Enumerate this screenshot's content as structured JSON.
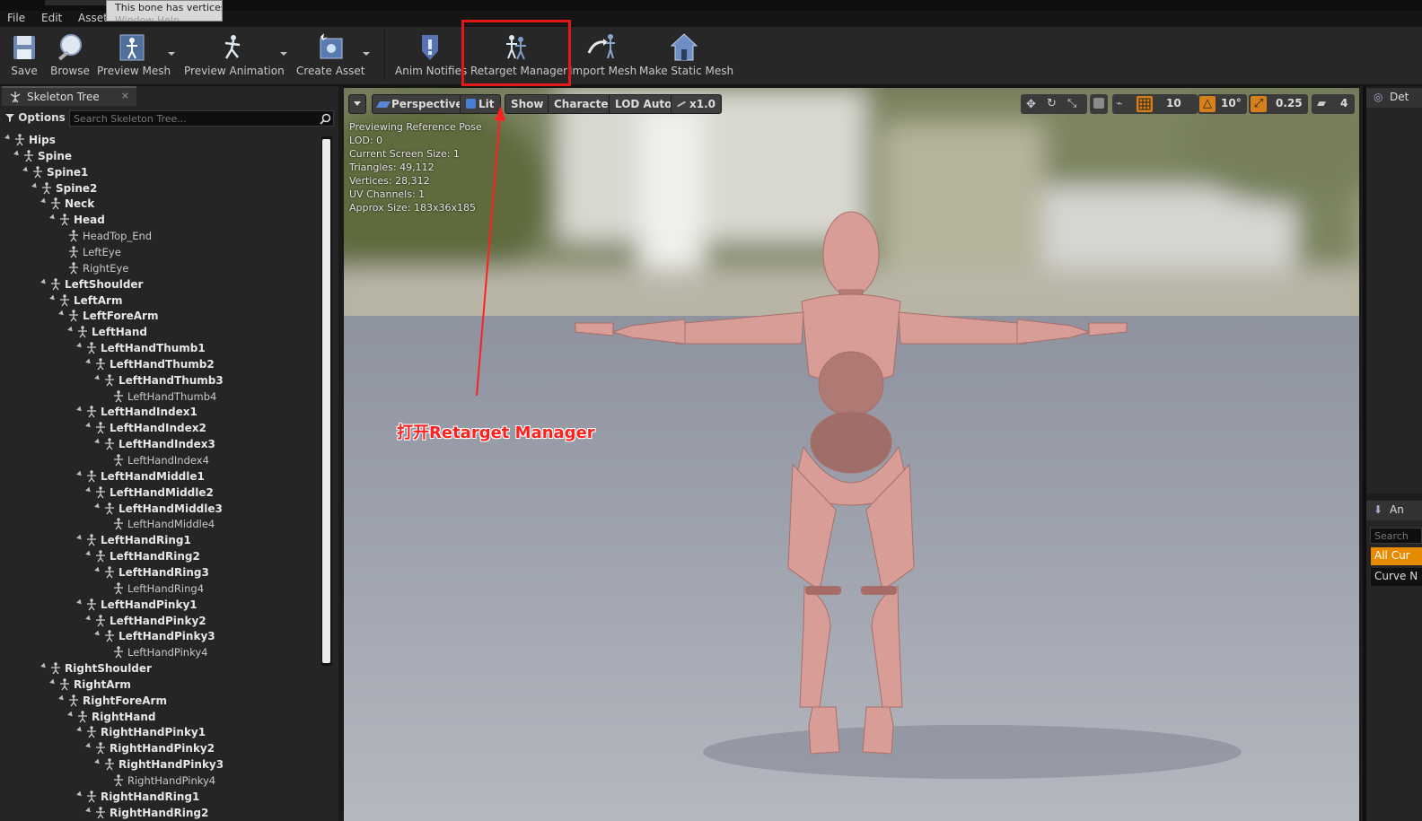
{
  "window": {
    "tooltip": {
      "line1": "This bone has vertices w",
      "line2": "Window   Help"
    }
  },
  "menu": [
    "File",
    "Edit",
    "Asset",
    "Window",
    "Help"
  ],
  "toolbar": {
    "buttons": [
      {
        "label": "Save",
        "icon": "save-icon"
      },
      {
        "label": "Browse",
        "icon": "browse-icon"
      },
      {
        "label": "Preview Mesh",
        "icon": "preview-mesh-icon"
      },
      {
        "label": "Preview Animation",
        "icon": "preview-animation-icon"
      },
      {
        "label": "Create Asset",
        "icon": "create-asset-icon"
      },
      {
        "label": "Anim Notifies",
        "icon": "anim-notifies-icon"
      },
      {
        "label": "Retarget Manager",
        "icon": "retarget-manager-icon"
      },
      {
        "label": "Import Mesh",
        "icon": "import-mesh-icon"
      },
      {
        "label": "Make Static Mesh",
        "icon": "make-static-mesh-icon"
      }
    ]
  },
  "skeleton_tree": {
    "tab_label": "Skeleton Tree",
    "tab_close": "×",
    "options_label": "Options",
    "search_placeholder": "Search Skeleton Tree...",
    "nodes": [
      {
        "name": "Hips",
        "depth": 0,
        "expanded": true,
        "bold": true
      },
      {
        "name": "Spine",
        "depth": 1,
        "expanded": true,
        "bold": true
      },
      {
        "name": "Spine1",
        "depth": 2,
        "expanded": true,
        "bold": true
      },
      {
        "name": "Spine2",
        "depth": 3,
        "expanded": true,
        "bold": true
      },
      {
        "name": "Neck",
        "depth": 4,
        "expanded": true,
        "bold": true
      },
      {
        "name": "Head",
        "depth": 5,
        "expanded": true,
        "bold": true
      },
      {
        "name": "HeadTop_End",
        "depth": 6,
        "expanded": false,
        "bold": false
      },
      {
        "name": "LeftEye",
        "depth": 6,
        "expanded": false,
        "bold": false
      },
      {
        "name": "RightEye",
        "depth": 6,
        "expanded": false,
        "bold": false
      },
      {
        "name": "LeftShoulder",
        "depth": 4,
        "expanded": true,
        "bold": true
      },
      {
        "name": "LeftArm",
        "depth": 5,
        "expanded": true,
        "bold": true
      },
      {
        "name": "LeftForeArm",
        "depth": 6,
        "expanded": true,
        "bold": true
      },
      {
        "name": "LeftHand",
        "depth": 7,
        "expanded": true,
        "bold": true
      },
      {
        "name": "LeftHandThumb1",
        "depth": 8,
        "expanded": true,
        "bold": true
      },
      {
        "name": "LeftHandThumb2",
        "depth": 9,
        "expanded": true,
        "bold": true
      },
      {
        "name": "LeftHandThumb3",
        "depth": 10,
        "expanded": true,
        "bold": true
      },
      {
        "name": "LeftHandThumb4",
        "depth": 11,
        "expanded": false,
        "bold": false
      },
      {
        "name": "LeftHandIndex1",
        "depth": 8,
        "expanded": true,
        "bold": true
      },
      {
        "name": "LeftHandIndex2",
        "depth": 9,
        "expanded": true,
        "bold": true
      },
      {
        "name": "LeftHandIndex3",
        "depth": 10,
        "expanded": true,
        "bold": true
      },
      {
        "name": "LeftHandIndex4",
        "depth": 11,
        "expanded": false,
        "bold": false
      },
      {
        "name": "LeftHandMiddle1",
        "depth": 8,
        "expanded": true,
        "bold": true
      },
      {
        "name": "LeftHandMiddle2",
        "depth": 9,
        "expanded": true,
        "bold": true
      },
      {
        "name": "LeftHandMiddle3",
        "depth": 10,
        "expanded": true,
        "bold": true
      },
      {
        "name": "LeftHandMiddle4",
        "depth": 11,
        "expanded": false,
        "bold": false
      },
      {
        "name": "LeftHandRing1",
        "depth": 8,
        "expanded": true,
        "bold": true
      },
      {
        "name": "LeftHandRing2",
        "depth": 9,
        "expanded": true,
        "bold": true
      },
      {
        "name": "LeftHandRing3",
        "depth": 10,
        "expanded": true,
        "bold": true
      },
      {
        "name": "LeftHandRing4",
        "depth": 11,
        "expanded": false,
        "bold": false
      },
      {
        "name": "LeftHandPinky1",
        "depth": 8,
        "expanded": true,
        "bold": true
      },
      {
        "name": "LeftHandPinky2",
        "depth": 9,
        "expanded": true,
        "bold": true
      },
      {
        "name": "LeftHandPinky3",
        "depth": 10,
        "expanded": true,
        "bold": true
      },
      {
        "name": "LeftHandPinky4",
        "depth": 11,
        "expanded": false,
        "bold": false
      },
      {
        "name": "RightShoulder",
        "depth": 4,
        "expanded": true,
        "bold": true
      },
      {
        "name": "RightArm",
        "depth": 5,
        "expanded": true,
        "bold": true
      },
      {
        "name": "RightForeArm",
        "depth": 6,
        "expanded": true,
        "bold": true
      },
      {
        "name": "RightHand",
        "depth": 7,
        "expanded": true,
        "bold": true
      },
      {
        "name": "RightHandPinky1",
        "depth": 8,
        "expanded": true,
        "bold": true
      },
      {
        "name": "RightHandPinky2",
        "depth": 9,
        "expanded": true,
        "bold": true
      },
      {
        "name": "RightHandPinky3",
        "depth": 10,
        "expanded": true,
        "bold": true
      },
      {
        "name": "RightHandPinky4",
        "depth": 11,
        "expanded": false,
        "bold": false
      },
      {
        "name": "RightHandRing1",
        "depth": 8,
        "expanded": true,
        "bold": true
      },
      {
        "name": "RightHandRing2",
        "depth": 9,
        "expanded": true,
        "bold": true
      }
    ]
  },
  "viewport": {
    "buttons": {
      "perspective": "Perspective",
      "lit": "Lit",
      "show": "Show",
      "character": "Character",
      "lod": "LOD Auto",
      "speed": "x1.0"
    },
    "tools": {
      "grid_snap": "10",
      "rotation_snap": "10°",
      "scale_snap": "0.25",
      "camera_speed": "4"
    },
    "stats": [
      "Previewing Reference Pose",
      "LOD: 0",
      "Current Screen Size: 1",
      "Triangles: 49,112",
      "Vertices: 28,312",
      "UV Channels: 1",
      "Approx Size: 183x36x185"
    ]
  },
  "annotation": {
    "text": "打开Retarget Manager",
    "color": "#ff2020"
  },
  "right_panel": {
    "details_tab": "Det",
    "anim_tab": "An",
    "search_placeholder": "Search",
    "all_curves": "All Cur",
    "curve_name": "Curve N"
  },
  "colors": {
    "highlight": "#e01818",
    "accent_orange": "#e68a00"
  }
}
